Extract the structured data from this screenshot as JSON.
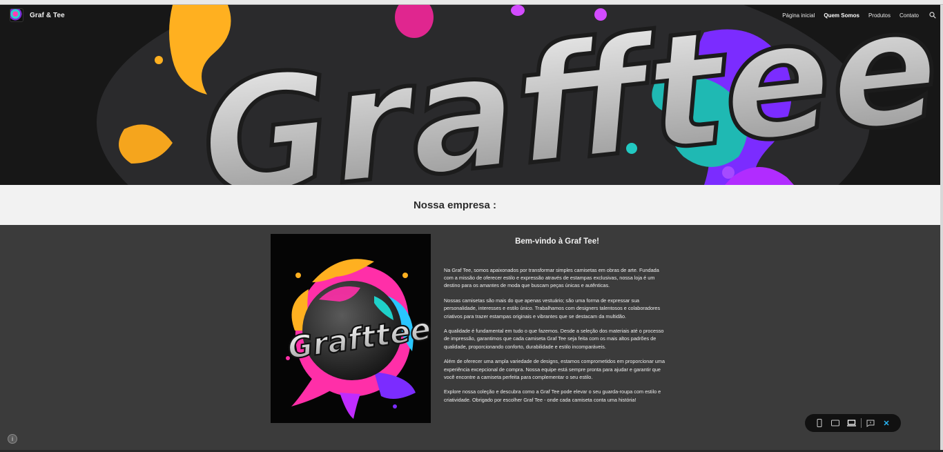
{
  "site": {
    "brand_name": "Graf & Tee",
    "nav": [
      {
        "label": "Página inicial",
        "active": false
      },
      {
        "label": "Quem Somos",
        "active": true
      },
      {
        "label": "Produtos",
        "active": false
      },
      {
        "label": "Contato",
        "active": false
      }
    ]
  },
  "hero": {
    "art_text": "Grafftee"
  },
  "section": {
    "title": "Nossa empresa :"
  },
  "about": {
    "logo_text": "Grafttee",
    "welcome": "Bem-vindo à Graf Tee!",
    "paragraphs": [
      "Na Graf Tee, somos apaixonados por transformar simples camisetas em obras de arte. Fundada com a missão de oferecer estilo e expressão através de estampas exclusivas, nossa loja é um destino para os amantes de moda que buscam peças únicas e autênticas.",
      "Nossas camisetas são mais do que apenas vestuário; são uma forma de expressar sua personalidade, interesses e estilo único. Trabalhamos com designers talentosos e colaboradores criativos para trazer estampas originais e vibrantes que se destacam da multidão.",
      "A qualidade é fundamental em tudo o que fazemos. Desde a seleção dos materiais até o processo de impressão, garantimos que cada camiseta Graf Tee seja feita com os mais altos padrões de qualidade, proporcionando conforto, durabilidade e estilo incomparáveis.",
      "Além de oferecer uma ampla variedade de designs, estamos comprometidos em proporcionar uma experiência excepcional de compra. Nossa equipe está sempre pronta para ajudar e garantir que você encontre a camiseta perfeita para complementar o seu estilo.",
      "Explore nossa coleção e descubra como a Graf Tee pode elevar o seu guarda-roupa com estilo e criatividade. Obrigado por escolher Graf Tee - onde cada camiseta conta uma história!"
    ]
  },
  "toolbar": {
    "buttons": [
      "phone-icon",
      "tablet-icon",
      "laptop-icon",
      "feedback-icon",
      "close-icon"
    ],
    "accent": "#29b6f6"
  },
  "colors": {
    "hero_bg": "#151515",
    "title_band": "#f2f2f2",
    "content_bg": "#3b3b3b",
    "pink": "#ff2fa8",
    "orange": "#ffb020",
    "teal": "#1fd1c9",
    "purple": "#7b2cff"
  }
}
